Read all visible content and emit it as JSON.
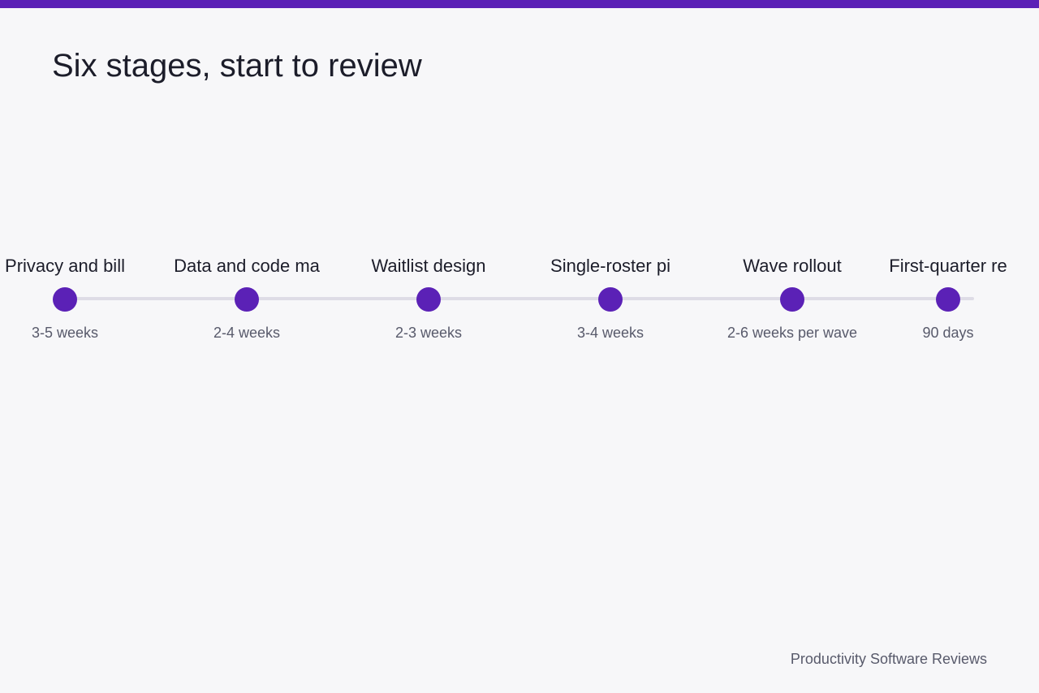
{
  "title": "Six stages, start to review",
  "footer": {
    "brand": "Productivity Software Reviews"
  },
  "colors": {
    "accent": "#5b21b6",
    "track": "#dedce6",
    "background": "#f7f7f9"
  },
  "stages": [
    {
      "label": "Privacy and bill",
      "duration": "3-5 weeks"
    },
    {
      "label": "Data and code ma",
      "duration": "2-4 weeks"
    },
    {
      "label": "Waitlist design",
      "duration": "2-3 weeks"
    },
    {
      "label": "Single-roster pi",
      "duration": "3-4 weeks"
    },
    {
      "label": "Wave rollout",
      "duration": "2-6 weeks per wave"
    },
    {
      "label": "First-quarter re",
      "duration": "90 days"
    }
  ]
}
